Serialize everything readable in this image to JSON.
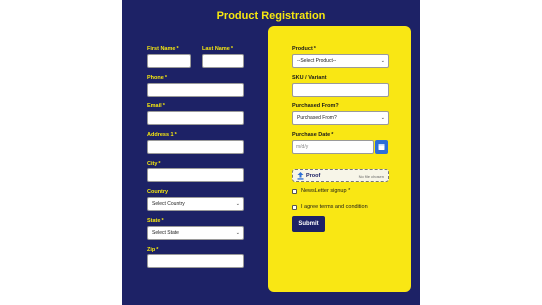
{
  "form": {
    "title": "Product Registration",
    "left": {
      "first_name_label": "First Name",
      "last_name_label": "Last Name",
      "phone_label": "Phone",
      "email_label": "Email",
      "address1_label": "Address 1",
      "city_label": "City",
      "country_label": "Country",
      "country_value": "Select Country",
      "state_label": "State",
      "state_value": "Select State",
      "zip_label": "Zip",
      "required_mark": "*"
    },
    "right": {
      "product_label": "Product",
      "product_value": "--Select Product--",
      "sku_label": "SKU / Variant",
      "purchased_from_label": "Purchased From?",
      "purchased_from_value": "Purchased From?",
      "purchase_date_label": "Purchase Date",
      "purchase_date_placeholder": "m/d/y",
      "proof_label": "Proof",
      "proof_hint": "No file chosen",
      "newsletter_label": "NewsLetter signup",
      "terms_label": "I agree terms and condition",
      "submit_label": "Submit",
      "required_mark": "*"
    }
  },
  "colors": {
    "panel_bg": "#1d2266",
    "accent_yellow": "#f9e714",
    "calendar_button": "#2e6fd6"
  },
  "icons": {
    "chevron": "chevron-down-icon",
    "calendar": "calendar-icon",
    "upload": "upload-icon"
  }
}
